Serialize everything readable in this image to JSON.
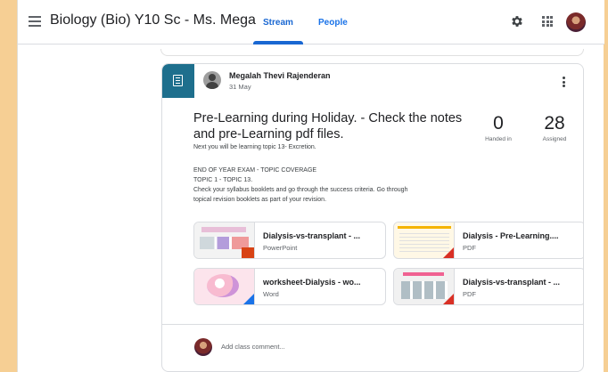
{
  "header": {
    "class_title": "Biology (Bio) Y10 Sc - Ms. Mega",
    "tabs": [
      {
        "label": "Stream"
      },
      {
        "label": "People"
      }
    ]
  },
  "post": {
    "author": "Megalah Thevi Rajenderan",
    "date": "31 May",
    "title": "Pre-Learning during Holiday. - Check the notes and pre-Learning pdf files.",
    "subtitle": "Next you will be learning topic 13- Excretion.",
    "body_lines": [
      "END OF YEAR EXAM - TOPIC COVERAGE",
      "TOPIC 1 - TOPIC 13.",
      "Check your syllabus booklets and go through the success criteria. Go through",
      "topical revision booklets as part of your revision."
    ],
    "stats": {
      "handed_in": {
        "value": "0",
        "label": "Handed in"
      },
      "assigned": {
        "value": "28",
        "label": "Assigned"
      }
    },
    "attachments": [
      {
        "name": "Dialysis-vs-transplant - ...",
        "type": "PowerPoint"
      },
      {
        "name": "Dialysis - Pre-Learning....",
        "type": "PDF"
      },
      {
        "name": "worksheet-Dialysis - wo...",
        "type": "Word"
      },
      {
        "name": "Dialysis-vs-transplant - ...",
        "type": "PDF"
      }
    ],
    "comment_placeholder": "Add class comment..."
  },
  "colors": {
    "accent": "#1967d2",
    "assignment_badge": "#1e6f8d",
    "page_border": "#f6cf94"
  }
}
